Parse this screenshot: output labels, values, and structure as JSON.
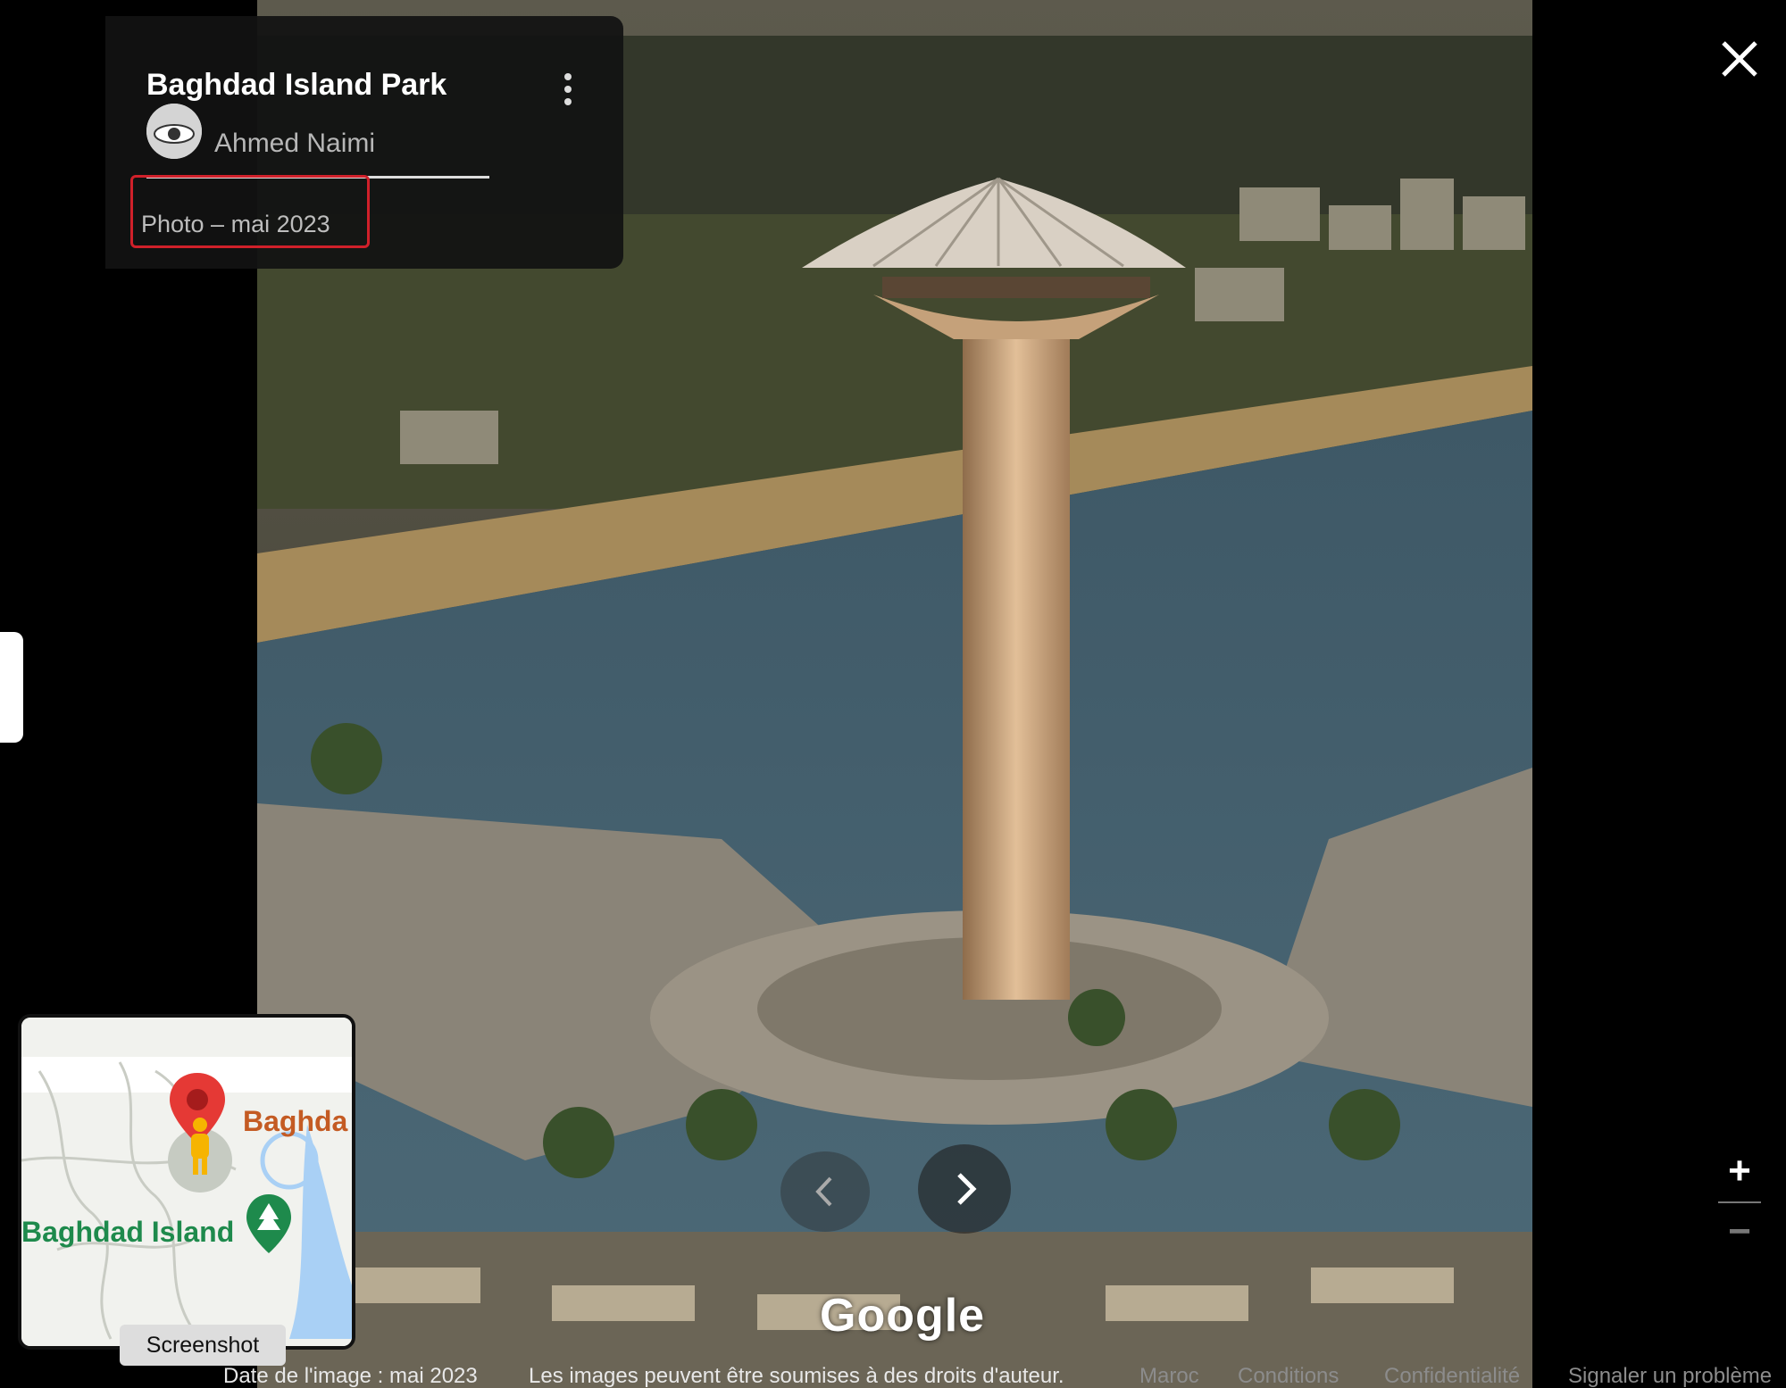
{
  "place": {
    "title": "Baghdad Island Park",
    "author": "Ahmed Naimi",
    "photo_date": "Photo – mai 2023"
  },
  "icons": {
    "more": "more-vert-icon",
    "close": "close-icon",
    "prev": "chevron-left-icon",
    "next": "chevron-right-icon",
    "zoom_in": "plus-icon",
    "zoom_out": "minus-icon",
    "pegman": "pegman-icon",
    "map_pin": "map-pin-icon",
    "park_marker": "tree-marker-icon"
  },
  "watermark": "Google",
  "zoom": {
    "plus": "+",
    "minus": "−"
  },
  "minimap": {
    "label_top": "Baghda",
    "label_bottom": "Baghdad Island"
  },
  "tooltip": "Screenshot",
  "footer": {
    "image_date": "Date de l'image : mai 2023",
    "copyright": "Les images peuvent être soumises à des droits d'auteur.",
    "links": [
      "Maroc",
      "Conditions",
      "Confidentialité",
      "Signaler un problème"
    ]
  },
  "colors": {
    "highlight_border": "#d0202a",
    "map_pin_red": "#e53935",
    "park_green": "#1e8a4c",
    "water_blue": "#a9d0f5"
  }
}
